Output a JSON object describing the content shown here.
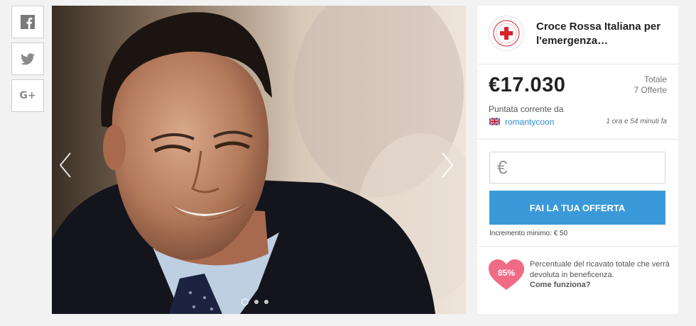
{
  "share": {
    "facebook_icon": "facebook-icon",
    "twitter_icon": "twitter-icon",
    "googleplus_icon": "google-plus-icon",
    "googleplus_label": "G+"
  },
  "gallery": {
    "photo_description": "photo-smiling-man-in-suit",
    "prev_icon": "chevron-left-icon",
    "next_icon": "chevron-right-icon",
    "dot_count": 3,
    "active_dot": 0
  },
  "organization": {
    "name": "Croce Rossa Italiana per l'emergenza…",
    "logo_icon": "red-cross-logo-icon"
  },
  "auction": {
    "price": "€17.030",
    "total_label": "Totale",
    "offers": "7 Offerte",
    "current_bid_label": "Puntata corrente da",
    "bidder_flag": "uk-flag-icon",
    "bidder": "romantycoon",
    "time_ago": "1 ora e 54 minuti fa"
  },
  "bid": {
    "currency_symbol": "€",
    "input_value": "",
    "button_label": "FAI LA TUA OFFERTA",
    "min_increment": "Incremento minimo: € 50"
  },
  "charity": {
    "percent": "85%",
    "text": "Percentuale del ricavato totale che verrà devoluta in beneficenza.",
    "link": "Come funziona?"
  },
  "colors": {
    "accent": "#3a9ad9",
    "heart": "#f06b86",
    "link": "#2e8bd8",
    "red_cross": "#d8232a"
  }
}
